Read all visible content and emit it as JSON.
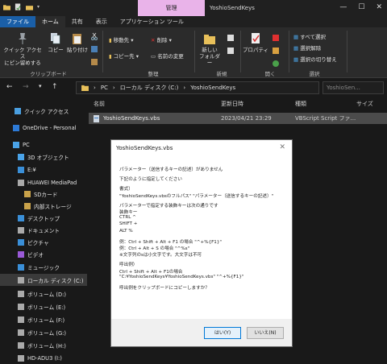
{
  "window": {
    "manage_tab": "管理",
    "title": "YoshioSendKeys",
    "minimize": "—",
    "maximize": "☐",
    "close": "✕"
  },
  "tabs": [
    "ファイル",
    "ホーム",
    "共有",
    "表示",
    "アプリケーション ツール"
  ],
  "ribbon": {
    "clipboard": {
      "quick_access": "クイック アクセス\nにピン留めする",
      "copy": "コピー",
      "paste": "貼り付け",
      "label": "クリップボード"
    },
    "organize": {
      "move": "移動先",
      "copy_to": "コピー先",
      "delete": "削除",
      "rename": "名前の変更",
      "label": "整理"
    },
    "new": {
      "folder": "新しい\nフォルダー",
      "label": "新規"
    },
    "open": {
      "properties": "プロパティ",
      "label": "開く"
    },
    "select": {
      "select_all": "すべて選択",
      "select_none": "選択解除",
      "invert": "選択の切り替え",
      "label": "選択"
    }
  },
  "address": {
    "parts": [
      "PC",
      "ローカル ディスク (C:)",
      "YoshioSendKeys"
    ],
    "search_placeholder": "YoshioSen..."
  },
  "sidebar": [
    {
      "label": "クイック アクセス",
      "icon": "star-icon",
      "color": "#4a9fe0"
    },
    {
      "label": "OneDrive - Personal",
      "icon": "cloud-icon",
      "color": "#2d7ad6"
    },
    {
      "label": "PC",
      "icon": "pc-icon",
      "color": "#4aa3e8"
    },
    {
      "label": "3D オブジェクト",
      "icon": "cube-icon",
      "color": "#4aa3e8"
    },
    {
      "label": "E:¥",
      "icon": "download-icon",
      "color": "#3a8fd8"
    },
    {
      "label": "HUAWEI MediaPad",
      "icon": "phone-icon",
      "color": "#aaaaaa"
    },
    {
      "label": "SDカード",
      "icon": "folder-icon",
      "color": "#c9a24a"
    },
    {
      "label": "内部ストレージ",
      "icon": "folder-icon",
      "color": "#c9a24a"
    },
    {
      "label": "デスクトップ",
      "icon": "desktop-icon",
      "color": "#3a8fd8"
    },
    {
      "label": "ドキュメント",
      "icon": "document-icon",
      "color": "#aaaaaa"
    },
    {
      "label": "ピクチャ",
      "icon": "picture-icon",
      "color": "#3a8fd8"
    },
    {
      "label": "ビデオ",
      "icon": "video-icon",
      "color": "#9a5ad8"
    },
    {
      "label": "ミュージック",
      "icon": "music-icon",
      "color": "#3a8fd8"
    },
    {
      "label": "ローカル ディスク (C:)",
      "icon": "disk-icon",
      "color": "#aaaaaa"
    },
    {
      "label": "ボリューム (D:)",
      "icon": "disk-icon",
      "color": "#aaaaaa"
    },
    {
      "label": "ボリューム (E:)",
      "icon": "disk-icon",
      "color": "#aaaaaa"
    },
    {
      "label": "ボリューム (F:)",
      "icon": "disk-icon",
      "color": "#aaaaaa"
    },
    {
      "label": "ボリューム (G:)",
      "icon": "disk-icon",
      "color": "#aaaaaa"
    },
    {
      "label": "ボリューム (H:)",
      "icon": "disk-icon",
      "color": "#aaaaaa"
    },
    {
      "label": "HD-ADU3 (I:)",
      "icon": "disk-icon",
      "color": "#aaaaaa"
    }
  ],
  "columns": {
    "name": "名前",
    "date": "更新日時",
    "type": "種類",
    "size": "サイズ"
  },
  "files": [
    {
      "name": "YoshioSendKeys.vbs",
      "date": "2023/04/21 23:29",
      "type": "VBScript Script ファ..."
    }
  ],
  "dialog": {
    "title": "YoshioSendKeys.vbs",
    "lines": [
      "パラメーター（送信するキーの記述）がありません",
      "",
      "下記のように指定してください",
      "",
      "書式）",
      "\"YoshioSendKeys.vbsのフルパス\" \"パラメーター（送信するキーの記述）\"",
      "",
      "パラメーターで指定する装飾キーは次の通りです",
      "装飾キー",
      "CTRL       ^",
      "SHIFT      +",
      "ALT        %",
      "",
      "例：Ctrl + Shift + Alt + F1 の場合 \"^+%{F1}\"",
      "例：Ctrl + Alt + S の場合 \"^%s\"",
      "※文字列のsは小文字です。大文字は不可",
      "",
      "呼出例）",
      "Ctrl + Shift + Alt + F1の場合",
      "\"C:¥YoshioSendKeys¥YoshioSendKeys.vbs\" \"^+%{F1}\"",
      "",
      "呼出例をクリップボードにコピーしますか？"
    ],
    "yes": "はい(Y)",
    "no": "いいえ(N)"
  }
}
